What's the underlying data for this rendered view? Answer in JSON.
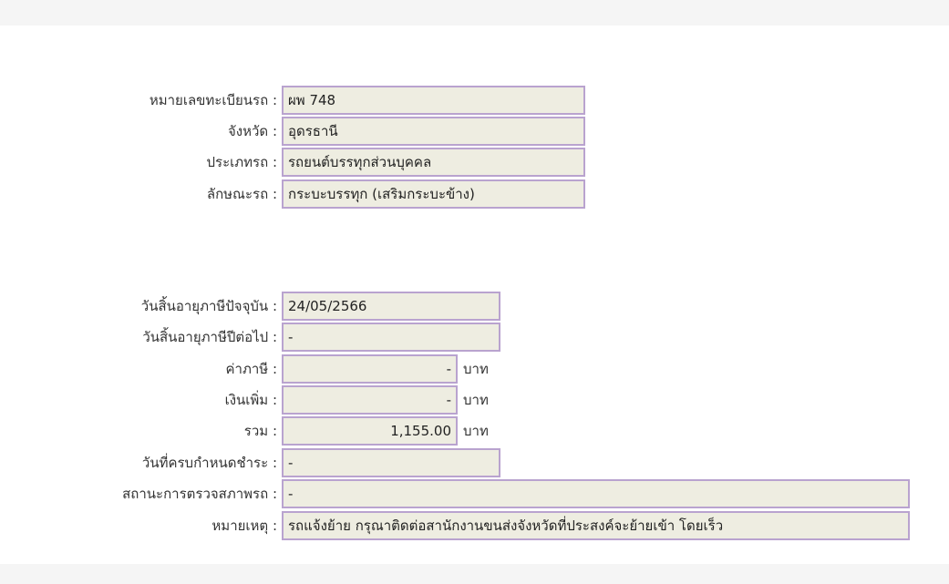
{
  "vehicle": {
    "plate": {
      "label": "หมายเลขทะเบียนรถ",
      "value": "ผพ 748"
    },
    "province": {
      "label": "จังหวัด",
      "value": "อุดรธานี"
    },
    "type": {
      "label": "ประเภทรถ",
      "value": "รถยนต์บรรทุกส่วนบุคคล"
    },
    "body": {
      "label": "ลักษณะรถ",
      "value": "กระบะบรรทุก (เสริมกระบะข้าง)"
    }
  },
  "tax": {
    "current_expiry": {
      "label": "วันสิ้นอายุภาษีปัจจุบัน",
      "value": "24/05/2566"
    },
    "next_expiry": {
      "label": "วันสิ้นอายุภาษีปีต่อไป",
      "value": "-"
    },
    "tax_amount": {
      "label": "ค่าภาษี",
      "value": "-",
      "unit": "บาท"
    },
    "surcharge": {
      "label": "เงินเพิ่ม",
      "value": "-",
      "unit": "บาท"
    },
    "total": {
      "label": "รวม",
      "value": "1,155.00",
      "unit": "บาท"
    },
    "due_date": {
      "label": "วันที่ครบกำหนดชำระ",
      "value": "-"
    },
    "inspection_status": {
      "label": "สถานะการตรวจสภาพรถ",
      "value": "-"
    },
    "remark": {
      "label": "หมายเหตุ",
      "value": "รถแจ้งย้าย กรุณาติดต่อสานักงานขนส่งจังหวัดที่ประสงค์จะย้ายเข้า โดยเร็ว"
    }
  }
}
